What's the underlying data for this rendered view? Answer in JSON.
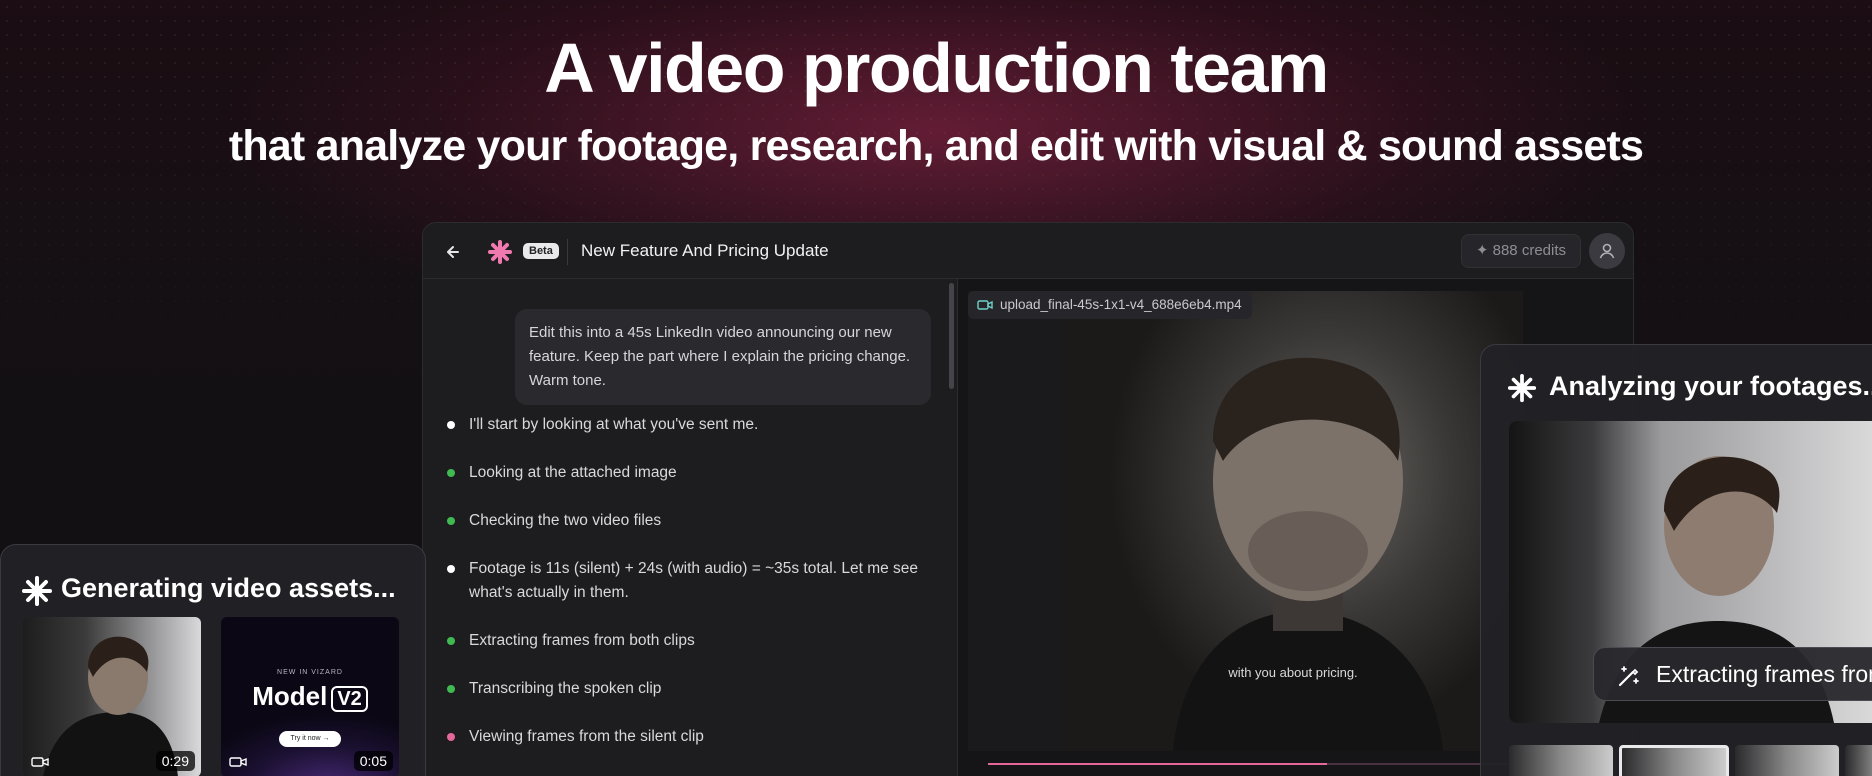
{
  "hero": {
    "title": "A video production team",
    "subtitle": "that analyze your footage, research, and edit with visual & sound assets"
  },
  "app": {
    "beta_label": "Beta",
    "project_title": "New Feature And Pricing Update",
    "credits": "888 credits",
    "icons": [
      "back-arrow-icon",
      "logo-icon",
      "sparkle-icon",
      "user-icon",
      "video-camera-icon"
    ]
  },
  "chat": {
    "user_message": "Edit this into a 45s LinkedIn video announcing our new feature. Keep the part where I explain the pricing change. Warm tone.",
    "steps": [
      {
        "text": "I'll start by looking at what you've sent me.",
        "status_color": "#ffffff"
      },
      {
        "text": "Looking at the attached image",
        "status_color": "#3fb950"
      },
      {
        "text": "Checking the two video files",
        "status_color": "#3fb950"
      },
      {
        "text": "Footage is 11s (silent) + 24s (with audio) = ~35s total. Let me see what's actually in them.",
        "status_color": "#ffffff"
      },
      {
        "text": "Extracting frames from both clips",
        "status_color": "#3fb950"
      },
      {
        "text": "Transcribing the spoken clip",
        "status_color": "#3fb950"
      },
      {
        "text": "Viewing frames from the silent clip",
        "status_color": "#e4699a"
      }
    ]
  },
  "player": {
    "file_name": "upload_final-45s-1x1-v4_688e6eb4.mp4",
    "caption": "with you about pricing.",
    "progress": 0.64
  },
  "cards": {
    "generating": {
      "title": "Generating video assets...",
      "thumbs": [
        {
          "duration": "0:29"
        },
        {
          "duration": "0:05",
          "new_label": "NEW IN VIZARD",
          "model_label": "Model",
          "version_label": "V2",
          "cta": "Try it now →"
        }
      ]
    },
    "analyzing": {
      "title": "Analyzing your footages...",
      "pill": "Extracting frames from both clips"
    }
  },
  "colors": {
    "accent_pink": "#e4699a",
    "done_green": "#3fb950"
  }
}
